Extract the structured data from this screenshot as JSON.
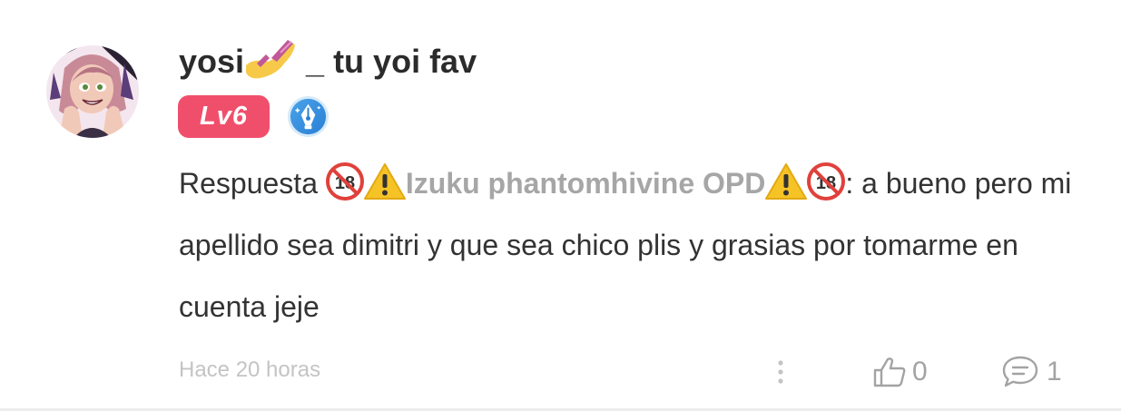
{
  "comment": {
    "author": {
      "name_prefix": "yosi",
      "name_suffix": " _ tu yoi fav",
      "name_emoji_icon": "nail-polish-icon",
      "level_label": "Lv6",
      "level_color": "#f04f6b",
      "writer_badge_icon": "fountain-pen-badge-icon"
    },
    "body": {
      "prefix": "Respuesta ",
      "mention": "Izuku phantomhivine OPD",
      "mention_leading_icons": [
        "no-under-18-icon",
        "warning-icon"
      ],
      "mention_trailing_icons": [
        "warning-icon",
        "no-under-18-icon"
      ],
      "after_mention": ": a bueno pero mi apellido sea dimitri y que sea chico plis y grasias por tomarme en cuenta jeje"
    },
    "footer": {
      "timestamp": "Hace 20 horas",
      "like_count": "0",
      "reply_count": "1",
      "like_icon": "thumbs-up-icon",
      "reply_icon": "speech-bubble-icon",
      "more_icon": "more-vertical-icon"
    }
  }
}
